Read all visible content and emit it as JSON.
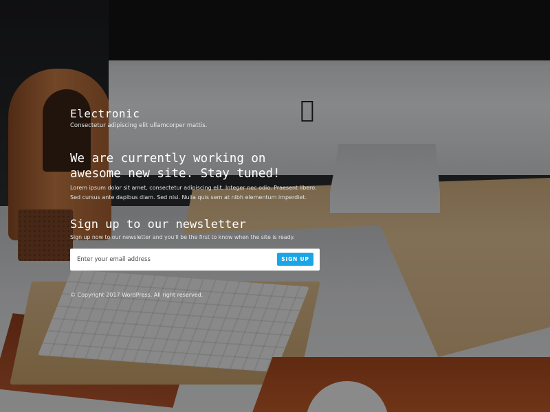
{
  "brand": {
    "title": "Electronic",
    "tagline": "Consectetur adipiscing elit ullamcorper mattis."
  },
  "hero": {
    "headline": "We are currently working on awesome new site. Stay tuned!",
    "description": "Lorem ipsum dolor sit amet, consectetur adipiscing elit. Integer nec odio. Praesent libero. Sed cursus ante dapibus diam. Sed nisi. Nulla quis sem at nibh elementum imperdiet."
  },
  "newsletter": {
    "heading": "Sign up to our newsletter",
    "subheading": "Sign up now to our newsletter and you'll be the first to know when the site is ready.",
    "email_placeholder": "Enter your email address",
    "email_value": "",
    "button_label": "SIGN UP"
  },
  "footer": {
    "copyright": "© Copyright 2017 WordPress. All right reserved."
  },
  "colors": {
    "button": "#1aa6e6",
    "overlay": "rgba(0,0,0,0.42)",
    "text": "#ffffff"
  },
  "background": {
    "icon": "apple-logo-icon"
  }
}
